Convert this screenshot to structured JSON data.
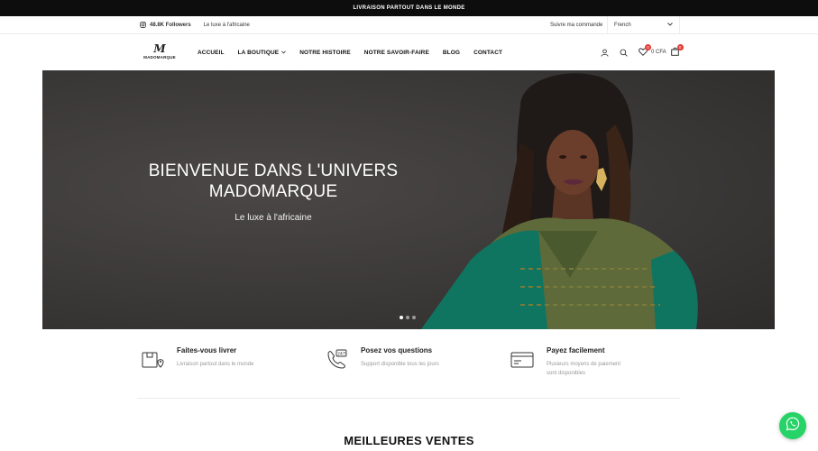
{
  "announcement": {
    "text": "LIVRAISON PARTOUT DANS LE MONDE"
  },
  "utility": {
    "followers": "48.8K Followers",
    "tagline": "Le luxe à l'africaine",
    "order_tracking": "Suivre ma commande",
    "language": "French"
  },
  "brand": {
    "logo_mark": "M",
    "logo_text": "MADOMARQUE"
  },
  "nav": {
    "items": [
      {
        "label": "ACCUEIL"
      },
      {
        "label": "LA BOUTIQUE"
      },
      {
        "label": "NOTRE HISTOIRE"
      },
      {
        "label": "NOTRE SAVOIR-FAIRE"
      },
      {
        "label": "BLOG"
      },
      {
        "label": "CONTACT"
      }
    ]
  },
  "header_icons": {
    "wishlist_count": "0",
    "cart_total": "0 CFA",
    "cart_count": "0",
    "icon_names": [
      "user-icon",
      "search-icon",
      "heart-icon",
      "cart-icon"
    ]
  },
  "hero": {
    "title_line1": "BIENVENUE DANS L'UNIVERS",
    "title_line2": "MADOMARQUE",
    "subtitle": "Le luxe à l'africaine",
    "slide_count": 3,
    "active_slide": 1
  },
  "features": [
    {
      "icon": "delivery-box-icon",
      "title": "Faites-vous livrer",
      "desc": "Livraison partout dans le monde"
    },
    {
      "icon": "phone-support-icon",
      "title": "Posez vos questions",
      "desc": "Support disponible tous les jours"
    },
    {
      "icon": "credit-card-icon",
      "title": "Payez facilement",
      "desc": "Plusieurs moyens de paiement sont disponibles"
    }
  ],
  "section": {
    "title": "MEILLEURES VENTES"
  },
  "colors": {
    "accent_green": "#25d366",
    "badge_red": "#e53935",
    "topbar": "#0d0d0d",
    "hero_bg": "#3b3938"
  }
}
